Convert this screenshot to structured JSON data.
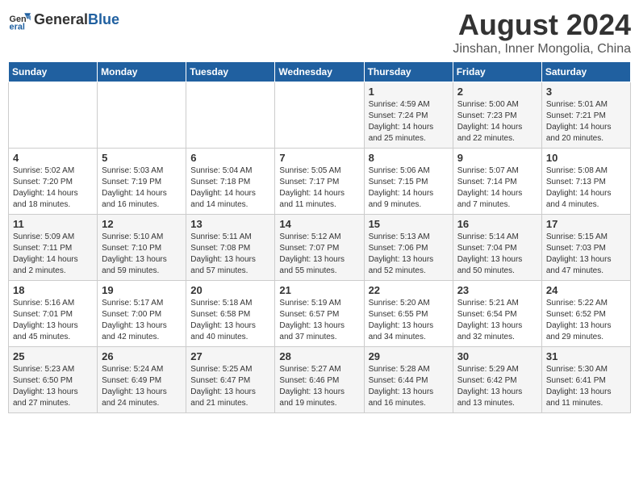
{
  "logo": {
    "general": "General",
    "blue": "Blue"
  },
  "title": "August 2024",
  "location": "Jinshan, Inner Mongolia, China",
  "weekdays": [
    "Sunday",
    "Monday",
    "Tuesday",
    "Wednesday",
    "Thursday",
    "Friday",
    "Saturday"
  ],
  "weeks": [
    [
      {
        "day": "",
        "info": ""
      },
      {
        "day": "",
        "info": ""
      },
      {
        "day": "",
        "info": ""
      },
      {
        "day": "",
        "info": ""
      },
      {
        "day": "1",
        "info": "Sunrise: 4:59 AM\nSunset: 7:24 PM\nDaylight: 14 hours\nand 25 minutes."
      },
      {
        "day": "2",
        "info": "Sunrise: 5:00 AM\nSunset: 7:23 PM\nDaylight: 14 hours\nand 22 minutes."
      },
      {
        "day": "3",
        "info": "Sunrise: 5:01 AM\nSunset: 7:21 PM\nDaylight: 14 hours\nand 20 minutes."
      }
    ],
    [
      {
        "day": "4",
        "info": "Sunrise: 5:02 AM\nSunset: 7:20 PM\nDaylight: 14 hours\nand 18 minutes."
      },
      {
        "day": "5",
        "info": "Sunrise: 5:03 AM\nSunset: 7:19 PM\nDaylight: 14 hours\nand 16 minutes."
      },
      {
        "day": "6",
        "info": "Sunrise: 5:04 AM\nSunset: 7:18 PM\nDaylight: 14 hours\nand 14 minutes."
      },
      {
        "day": "7",
        "info": "Sunrise: 5:05 AM\nSunset: 7:17 PM\nDaylight: 14 hours\nand 11 minutes."
      },
      {
        "day": "8",
        "info": "Sunrise: 5:06 AM\nSunset: 7:15 PM\nDaylight: 14 hours\nand 9 minutes."
      },
      {
        "day": "9",
        "info": "Sunrise: 5:07 AM\nSunset: 7:14 PM\nDaylight: 14 hours\nand 7 minutes."
      },
      {
        "day": "10",
        "info": "Sunrise: 5:08 AM\nSunset: 7:13 PM\nDaylight: 14 hours\nand 4 minutes."
      }
    ],
    [
      {
        "day": "11",
        "info": "Sunrise: 5:09 AM\nSunset: 7:11 PM\nDaylight: 14 hours\nand 2 minutes."
      },
      {
        "day": "12",
        "info": "Sunrise: 5:10 AM\nSunset: 7:10 PM\nDaylight: 13 hours\nand 59 minutes."
      },
      {
        "day": "13",
        "info": "Sunrise: 5:11 AM\nSunset: 7:08 PM\nDaylight: 13 hours\nand 57 minutes."
      },
      {
        "day": "14",
        "info": "Sunrise: 5:12 AM\nSunset: 7:07 PM\nDaylight: 13 hours\nand 55 minutes."
      },
      {
        "day": "15",
        "info": "Sunrise: 5:13 AM\nSunset: 7:06 PM\nDaylight: 13 hours\nand 52 minutes."
      },
      {
        "day": "16",
        "info": "Sunrise: 5:14 AM\nSunset: 7:04 PM\nDaylight: 13 hours\nand 50 minutes."
      },
      {
        "day": "17",
        "info": "Sunrise: 5:15 AM\nSunset: 7:03 PM\nDaylight: 13 hours\nand 47 minutes."
      }
    ],
    [
      {
        "day": "18",
        "info": "Sunrise: 5:16 AM\nSunset: 7:01 PM\nDaylight: 13 hours\nand 45 minutes."
      },
      {
        "day": "19",
        "info": "Sunrise: 5:17 AM\nSunset: 7:00 PM\nDaylight: 13 hours\nand 42 minutes."
      },
      {
        "day": "20",
        "info": "Sunrise: 5:18 AM\nSunset: 6:58 PM\nDaylight: 13 hours\nand 40 minutes."
      },
      {
        "day": "21",
        "info": "Sunrise: 5:19 AM\nSunset: 6:57 PM\nDaylight: 13 hours\nand 37 minutes."
      },
      {
        "day": "22",
        "info": "Sunrise: 5:20 AM\nSunset: 6:55 PM\nDaylight: 13 hours\nand 34 minutes."
      },
      {
        "day": "23",
        "info": "Sunrise: 5:21 AM\nSunset: 6:54 PM\nDaylight: 13 hours\nand 32 minutes."
      },
      {
        "day": "24",
        "info": "Sunrise: 5:22 AM\nSunset: 6:52 PM\nDaylight: 13 hours\nand 29 minutes."
      }
    ],
    [
      {
        "day": "25",
        "info": "Sunrise: 5:23 AM\nSunset: 6:50 PM\nDaylight: 13 hours\nand 27 minutes."
      },
      {
        "day": "26",
        "info": "Sunrise: 5:24 AM\nSunset: 6:49 PM\nDaylight: 13 hours\nand 24 minutes."
      },
      {
        "day": "27",
        "info": "Sunrise: 5:25 AM\nSunset: 6:47 PM\nDaylight: 13 hours\nand 21 minutes."
      },
      {
        "day": "28",
        "info": "Sunrise: 5:27 AM\nSunset: 6:46 PM\nDaylight: 13 hours\nand 19 minutes."
      },
      {
        "day": "29",
        "info": "Sunrise: 5:28 AM\nSunset: 6:44 PM\nDaylight: 13 hours\nand 16 minutes."
      },
      {
        "day": "30",
        "info": "Sunrise: 5:29 AM\nSunset: 6:42 PM\nDaylight: 13 hours\nand 13 minutes."
      },
      {
        "day": "31",
        "info": "Sunrise: 5:30 AM\nSunset: 6:41 PM\nDaylight: 13 hours\nand 11 minutes."
      }
    ]
  ]
}
